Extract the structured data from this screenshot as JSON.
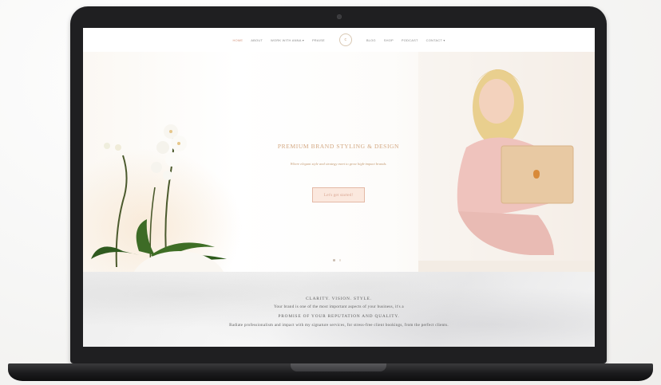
{
  "nav": {
    "left_items": [
      "HOME",
      "ABOUT",
      "WORK WITH ANNA",
      "PRAISE"
    ],
    "right_items": [
      "BLOG",
      "SHOP",
      "PODCAST",
      "CONTACT"
    ],
    "active": "HOME",
    "logo_glyph": "c"
  },
  "hero": {
    "title": "PREMIUM BRAND STYLING & DESIGN",
    "subtitle": "Where elegant style and strategy meet to grow high-impact brands.",
    "cta_label": "Let's get started!",
    "slides": 2,
    "active_slide": 1
  },
  "intro": {
    "line1": "CLARITY. VISION. STYLE.",
    "line2": "Your brand is one of the most important aspects of your business, it's a",
    "line3": "PROMISE OF YOUR REPUTATION AND QUALITY.",
    "line4": "Radiate professionalism and impact with my signature services, for stress-free client bookings, from the perfect clients."
  },
  "colors": {
    "accent": "#d4967f",
    "gold": "#d3a882",
    "laptop": "#1f1f21"
  },
  "icons": {
    "dropdown": "chevron-down-icon",
    "laptop_logo": "apple-icon"
  }
}
